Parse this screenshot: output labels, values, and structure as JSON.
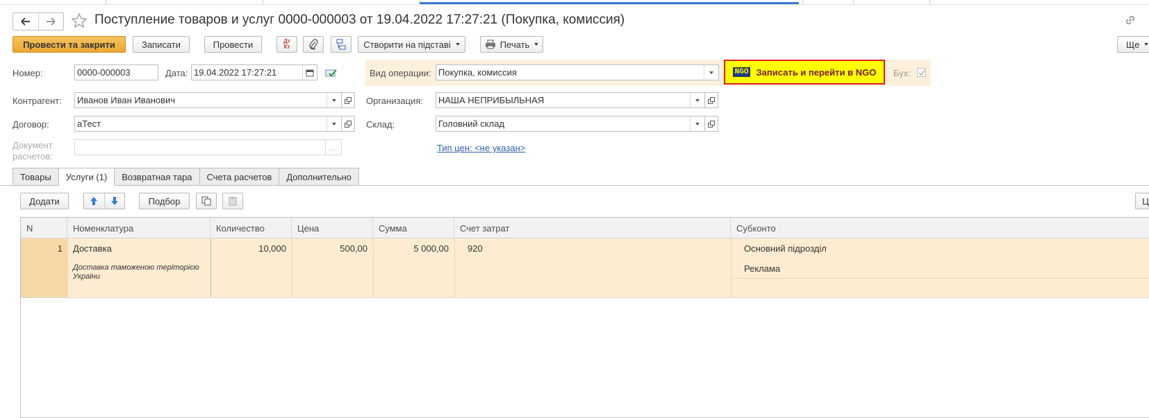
{
  "window": {
    "title": "Поступление товаров и услуг 0000-000003 от 19.04.2022 17:27:21 (Покупка, комиссия)"
  },
  "toolbar": {
    "post_close": "Провести та закрити",
    "save": "Записати",
    "post": "Провести",
    "dt_kt_icon": "Дт Кт",
    "create_based": "Створити на підставі",
    "print": "Печать",
    "more": "Ще"
  },
  "form": {
    "number_label": "Номер:",
    "number_value": "0000-000003",
    "date_label": "Дата:",
    "date_value": "19.04.2022 17:27:21",
    "optype_label": "Вид операции:",
    "optype_value": "Покупка, комиссия",
    "ngo_badge": "NGO",
    "ngo_button": "Записать и перейти в NGO",
    "buh_label": "Бух:",
    "contractor_label": "Контрагент:",
    "contractor_value": "Иванов Иван Иванович",
    "org_label": "Организация:",
    "org_value": "НАША НЕПРИБЫЛЬНАЯ",
    "contract_label": "Договор:",
    "contract_value": "аТест",
    "warehouse_label": "Склад:",
    "warehouse_value": "Головний склад",
    "settlement_doc_label_1": "Документ",
    "settlement_doc_label_2": "расчетов:",
    "settlement_doc_value": "",
    "price_type_link": "Тип цен: <не указан>"
  },
  "tabs": [
    {
      "label": "Товары"
    },
    {
      "label": "Услуги (1)"
    },
    {
      "label": "Возвратная тара"
    },
    {
      "label": "Счета расчетов"
    },
    {
      "label": "Дополнительно"
    }
  ],
  "table_toolbar": {
    "add": "Додати",
    "selection": "Подбор"
  },
  "table": {
    "headers": [
      "N",
      "Номенклатура",
      "Количество",
      "Цена",
      "Сумма",
      "Счет затрат",
      "Субконто"
    ],
    "rows": [
      {
        "n": "1",
        "item": "Доставка",
        "item_desc_1": "Доставка таможеною теріторією",
        "item_desc_2": "України",
        "qty": "10,000",
        "price": "500,00",
        "sum": "5 000,00",
        "account": "920",
        "subconto_1": "Основний підрозділ",
        "subconto_2": "Реклама"
      }
    ]
  }
}
